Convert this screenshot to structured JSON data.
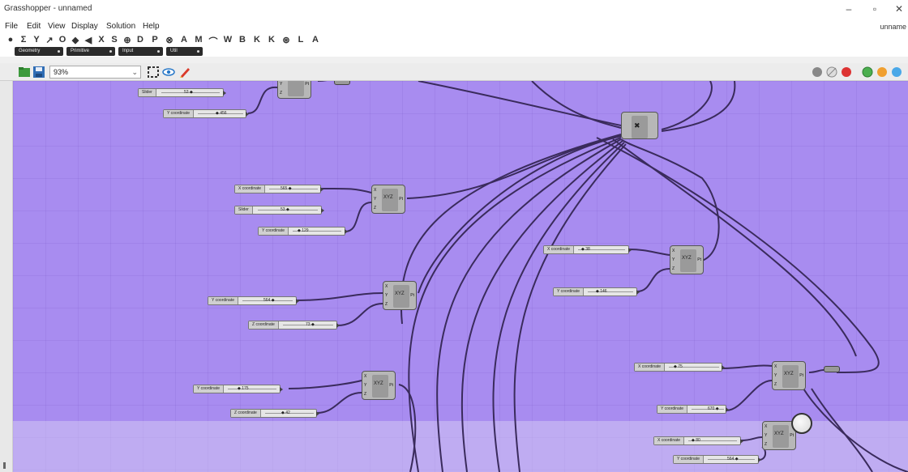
{
  "window": {
    "title": "Grasshopper - unnamed",
    "doc_label": "unname",
    "controls": [
      "–",
      "▫",
      "✕"
    ]
  },
  "menu": [
    "File",
    "Edit",
    "View",
    "Display",
    "Solution",
    "Help"
  ],
  "component_icons": [
    "●",
    "Σ",
    "Y",
    "↗",
    "O",
    "◆",
    "◀",
    "X",
    "S",
    "⊕",
    "D",
    "P",
    "⊗",
    "A",
    "M",
    "⌒",
    "W",
    "B",
    "K",
    "K",
    "⊛",
    "L",
    "A"
  ],
  "category_tabs": [
    "Geometry",
    "Primitive",
    "Input",
    "Util"
  ],
  "canvas_toolbar": {
    "zoom": "93%"
  },
  "colors": {
    "canvas": "#a88cf0",
    "wire": "#3a2b5c"
  },
  "sliders": [
    {
      "label": "Slider",
      "value": "53 ◆"
    },
    {
      "label": "Y coordinate",
      "value": "◆ 456"
    },
    {
      "label": "X coordinate",
      "value": "565 ◆"
    },
    {
      "label": "Slider",
      "value": "53 ◆"
    },
    {
      "label": "Y coordinate",
      "value": "◆ 129"
    },
    {
      "label": "X coordinate",
      "value": "◆ 38"
    },
    {
      "label": "Y coordinate",
      "value": "◆ 146"
    },
    {
      "label": "Y coordinate",
      "value": "564 ◆"
    },
    {
      "label": "Z coordinate",
      "value": "73 ◆"
    },
    {
      "label": "X coordinate",
      "value": "◆ 75"
    },
    {
      "label": "Y coordinate",
      "value": "670 ◆"
    },
    {
      "label": "Y coordinate",
      "value": "◆ 175"
    },
    {
      "label": "Z coordinate",
      "value": "◆ 42"
    },
    {
      "label": "X coordinate",
      "value": "◆ 80"
    },
    {
      "label": "Y coordinate",
      "value": "564 ◆"
    }
  ],
  "point_component": {
    "inputs": [
      "X",
      "Y",
      "Z"
    ],
    "output": "Pt",
    "glyph": "XYZ"
  }
}
